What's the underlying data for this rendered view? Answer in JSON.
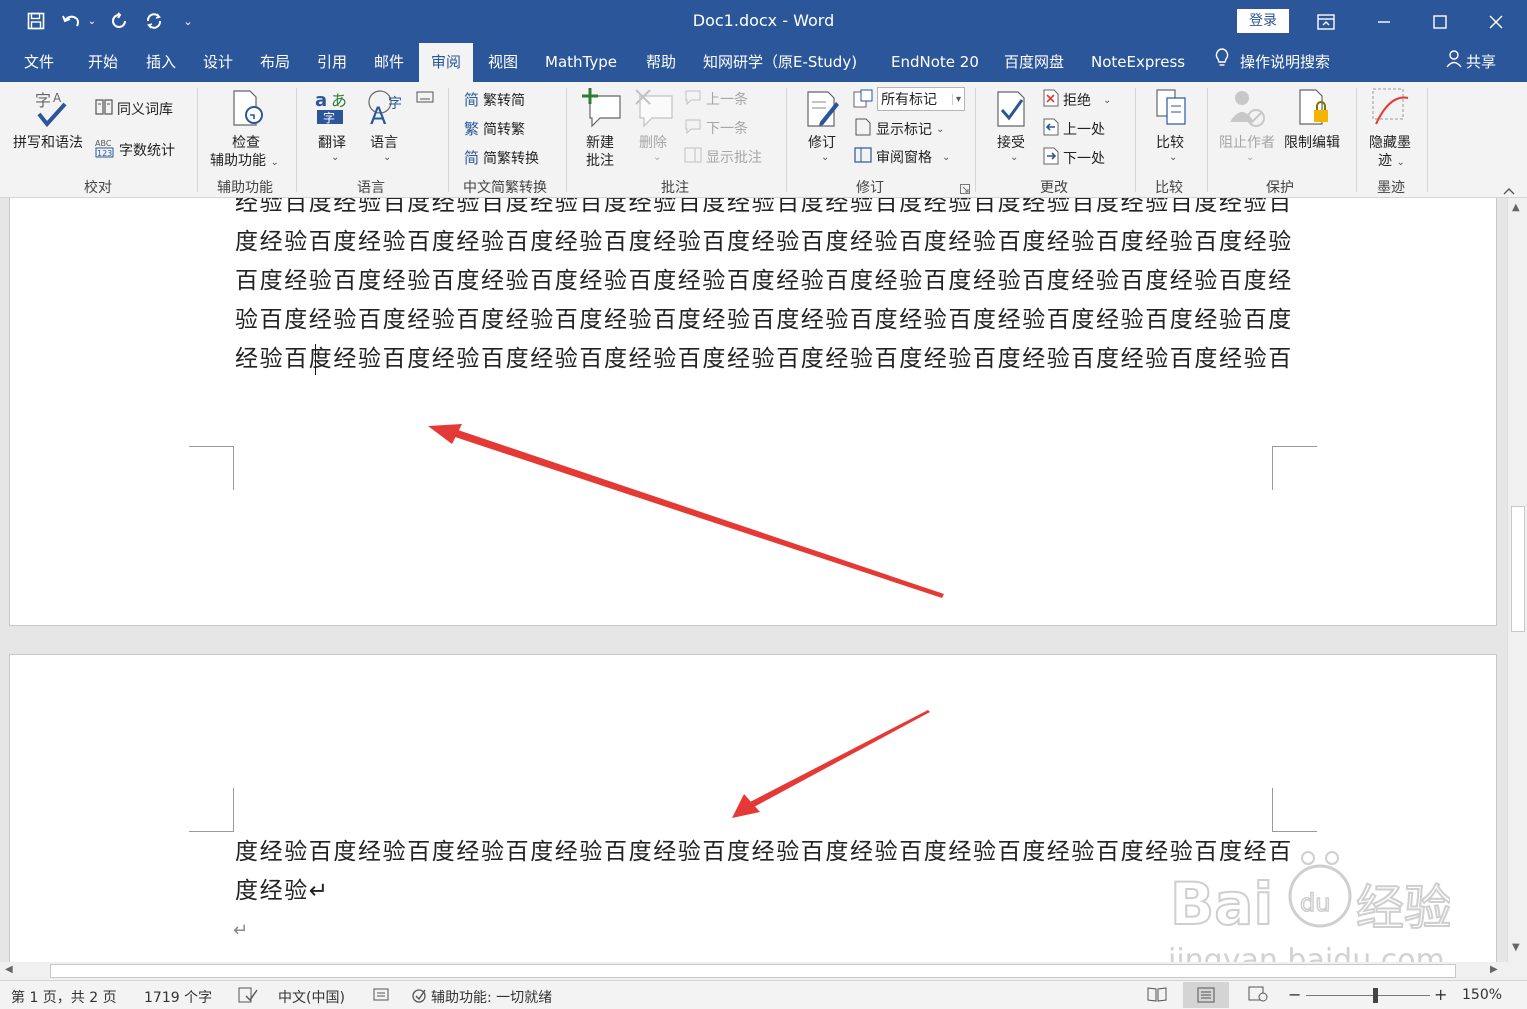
{
  "window": {
    "title": "Doc1.docx - Word",
    "signin": "登录",
    "minimize_icon": "minimize-icon",
    "restore_icon": "restore-icon",
    "close_icon": "close-icon"
  },
  "tabs": [
    "文件",
    "开始",
    "插入",
    "设计",
    "布局",
    "引用",
    "邮件",
    "审阅",
    "视图",
    "MathType",
    "帮助",
    "知网研学（原E-Study)",
    "EndNote 20",
    "百度网盘",
    "NoteExpress"
  ],
  "active_tab": "审阅",
  "tell_me": "操作说明搜索",
  "share": "共享",
  "ribbon": {
    "proofing": {
      "label": "校对",
      "spelling": "拼写和语法",
      "thesaurus": "同义词库",
      "wordcount": "字数统计"
    },
    "accessibility": {
      "label": "辅助功能",
      "check_line1": "检查",
      "check_line2": "辅助功能"
    },
    "language": {
      "label": "语言",
      "translate": "翻译",
      "language": "语言"
    },
    "chinese": {
      "label": "中文简繁转换",
      "to_simplified": "繁转简",
      "to_traditional": "简转繁",
      "convert": "简繁转换"
    },
    "comments": {
      "label": "批注",
      "new_line1": "新建",
      "new_line2": "批注",
      "delete": "删除",
      "prev": "上一条",
      "next": "下一条",
      "show": "显示批注"
    },
    "tracking": {
      "label": "修订",
      "track": "修订",
      "markup_select": "所有标记",
      "show_markup": "显示标记",
      "review_pane": "审阅窗格"
    },
    "changes": {
      "label": "更改",
      "accept": "接受",
      "reject": "拒绝",
      "prev": "上一处",
      "next": "下一处"
    },
    "compare": {
      "label": "比较",
      "compare": "比较"
    },
    "protect": {
      "label": "保护",
      "block_authors": "阻止作者",
      "restrict": "限制编辑"
    },
    "ink": {
      "label": "墨迹",
      "hide_line1": "隐藏墨",
      "hide_line2": "迹"
    }
  },
  "document": {
    "page1_lines": [
      "经验百度经验百度经验百度经验百度经验百度经验百度经验百度经验百度经验百度经验百度经验百",
      "度经验百度经验百度经验百度经验百度经验百度经验百度经验百度经验百度经验百度经验百度经验",
      "百度经验百度经验百度经验百度经验百度经验百度经验百度经验百度经验百度经验百度经验百度经",
      "验百度经验百度经验百度经验百度经验百度经验百度经验百度经验百度经验百度经验百度经验百度",
      "经验百度经验百度经验百度经验百度经验百度经验百度经验百度经验百度经验百度经验百度经验百"
    ],
    "page2_lines": [
      "度经验百度经验百度经验百度经验百度经验百度经验百度经验百度经验百度经验百度经验百度经百",
      "度经验↵",
      "↵"
    ]
  },
  "status": {
    "page": "第 1 页，共 2 页",
    "words": "1719 个字",
    "language": "中文(中国)",
    "accessibility": "辅助功能: 一切就绪",
    "zoom": "150%"
  },
  "colors": {
    "titlebar": "#2b579a",
    "ribbon": "#f3f3f3",
    "arrow": "#e53935"
  }
}
